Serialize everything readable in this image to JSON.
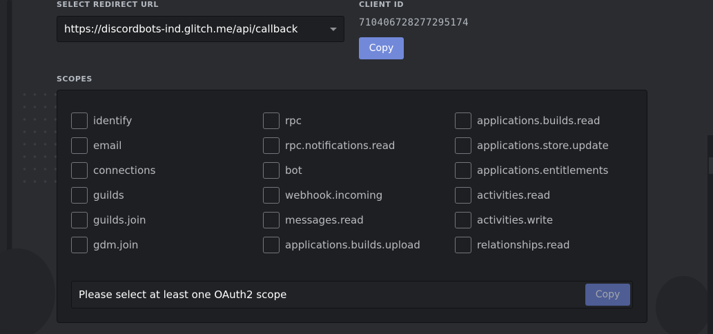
{
  "redirect": {
    "label": "SELECT REDIRECT URL",
    "value": "https://discordbots-ind.glitch.me/api/callback"
  },
  "client": {
    "label": "CLIENT ID",
    "id": "710406728277295174",
    "copy_label": "Copy"
  },
  "scopes": {
    "label": "SCOPES",
    "items": [
      "identify",
      "email",
      "connections",
      "guilds",
      "guilds.join",
      "gdm.join",
      "rpc",
      "rpc.notifications.read",
      "bot",
      "webhook.incoming",
      "messages.read",
      "applications.builds.upload",
      "applications.builds.read",
      "applications.store.update",
      "applications.entitlements",
      "activities.read",
      "activities.write",
      "relationships.read"
    ]
  },
  "generated_url": {
    "text": "Please select at least one OAuth2 scope",
    "copy_label": "Copy"
  },
  "colors": {
    "accent": "#7289da",
    "accent_disabled": "#4e5d94",
    "background": "#2a2c30",
    "panel": "#1e1f22"
  }
}
